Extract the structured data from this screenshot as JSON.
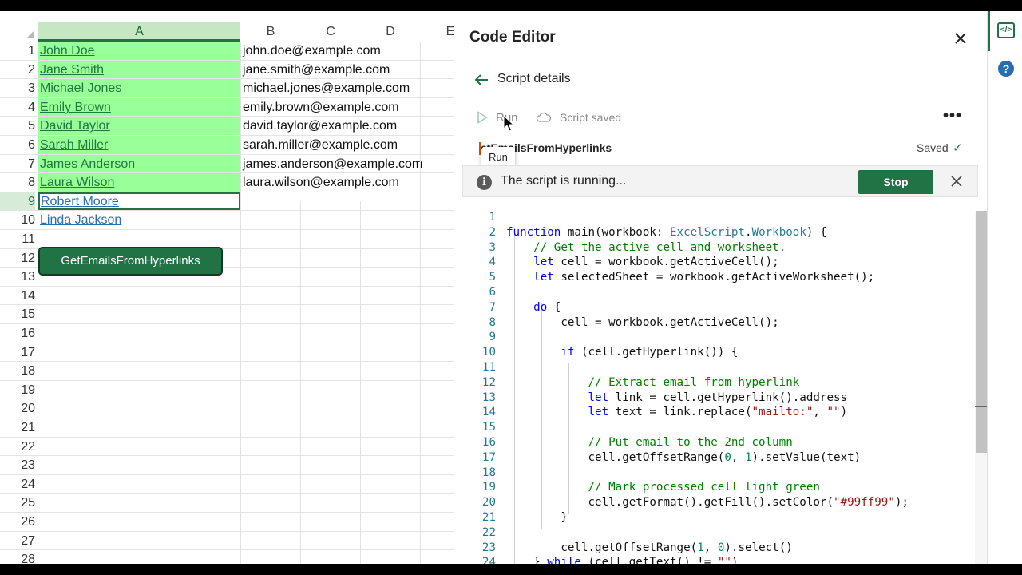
{
  "sheet": {
    "columns": [
      "A",
      "B",
      "C",
      "D",
      "E"
    ],
    "rows": [
      {
        "num": "1",
        "a": "John Doe",
        "b": "john.doe@example.com"
      },
      {
        "num": "2",
        "a": "Jane Smith",
        "b": "jane.smith@example.com"
      },
      {
        "num": "3",
        "a": "Michael Jones",
        "b": "michael.jones@example.com"
      },
      {
        "num": "4",
        "a": "Emily Brown",
        "b": "emily.brown@example.com"
      },
      {
        "num": "5",
        "a": "David Taylor",
        "b": "david.taylor@example.com"
      },
      {
        "num": "6",
        "a": "Sarah Miller",
        "b": "sarah.miller@example.com"
      },
      {
        "num": "7",
        "a": "James Anderson",
        "b": "james.anderson@example.com"
      },
      {
        "num": "8",
        "a": "Laura Wilson",
        "b": "laura.wilson@example.com"
      },
      {
        "num": "9",
        "a": "Robert Moore",
        "b": ""
      },
      {
        "num": "10",
        "a": "Linda Jackson",
        "b": ""
      },
      {
        "num": "11",
        "a": "",
        "b": ""
      },
      {
        "num": "12",
        "a": "",
        "b": ""
      },
      {
        "num": "13",
        "a": "",
        "b": ""
      },
      {
        "num": "14",
        "a": "",
        "b": ""
      },
      {
        "num": "15",
        "a": "",
        "b": ""
      },
      {
        "num": "16",
        "a": "",
        "b": ""
      },
      {
        "num": "17",
        "a": "",
        "b": ""
      },
      {
        "num": "18",
        "a": "",
        "b": ""
      },
      {
        "num": "19",
        "a": "",
        "b": ""
      },
      {
        "num": "20",
        "a": "",
        "b": ""
      },
      {
        "num": "21",
        "a": "",
        "b": ""
      },
      {
        "num": "22",
        "a": "",
        "b": ""
      },
      {
        "num": "23",
        "a": "",
        "b": ""
      },
      {
        "num": "24",
        "a": "",
        "b": ""
      },
      {
        "num": "25",
        "a": "",
        "b": ""
      },
      {
        "num": "26",
        "a": "",
        "b": ""
      },
      {
        "num": "27",
        "a": "",
        "b": ""
      },
      {
        "num": "28",
        "a": "",
        "b": ""
      }
    ],
    "filled_rows": 8,
    "active_row": 9,
    "fill_color": "#99ff99",
    "script_button_label": "GetEmailsFromHyperlinks"
  },
  "editor": {
    "title": "Code Editor",
    "back_label": "Script details",
    "run_label": "Run",
    "saved_status": "Script saved",
    "more_label": "•••",
    "script_name": "GetEmailsFromHyperlinks",
    "script_name_visible": "etEmailsFromHyperlinks",
    "saved_label": "Saved",
    "tooltip": "Run",
    "running_message": "The script is running...",
    "stop_label": "Stop",
    "code_lines": [
      "",
      "function main(workbook: ExcelScript.Workbook) {",
      "    // Get the active cell and worksheet.",
      "    let cell = workbook.getActiveCell();",
      "    let selectedSheet = workbook.getActiveWorksheet();",
      "",
      "    do {",
      "        cell = workbook.getActiveCell();",
      "",
      "        if (cell.getHyperlink()) {",
      "",
      "            // Extract email from hyperlink",
      "            let link = cell.getHyperlink().address",
      "            let text = link.replace(\"mailto:\", \"\")",
      "",
      "            // Put email to the 2nd column",
      "            cell.getOffsetRange(0, 1).setValue(text)",
      "",
      "            // Mark processed cell light green",
      "            cell.getFormat().getFill().setColor(\"#99ff99\");",
      "        }",
      "",
      "        cell.getOffsetRange(1, 0).select()",
      "    } while (cell.getText() != \"\")",
      "}"
    ]
  },
  "colors": {
    "accent": "#217346",
    "keyword": "#0000ff",
    "type": "#267f99",
    "comment": "#008000",
    "string": "#a31515",
    "number": "#098658"
  },
  "rail": {
    "icons": [
      "code-editor-icon",
      "help-icon"
    ]
  }
}
